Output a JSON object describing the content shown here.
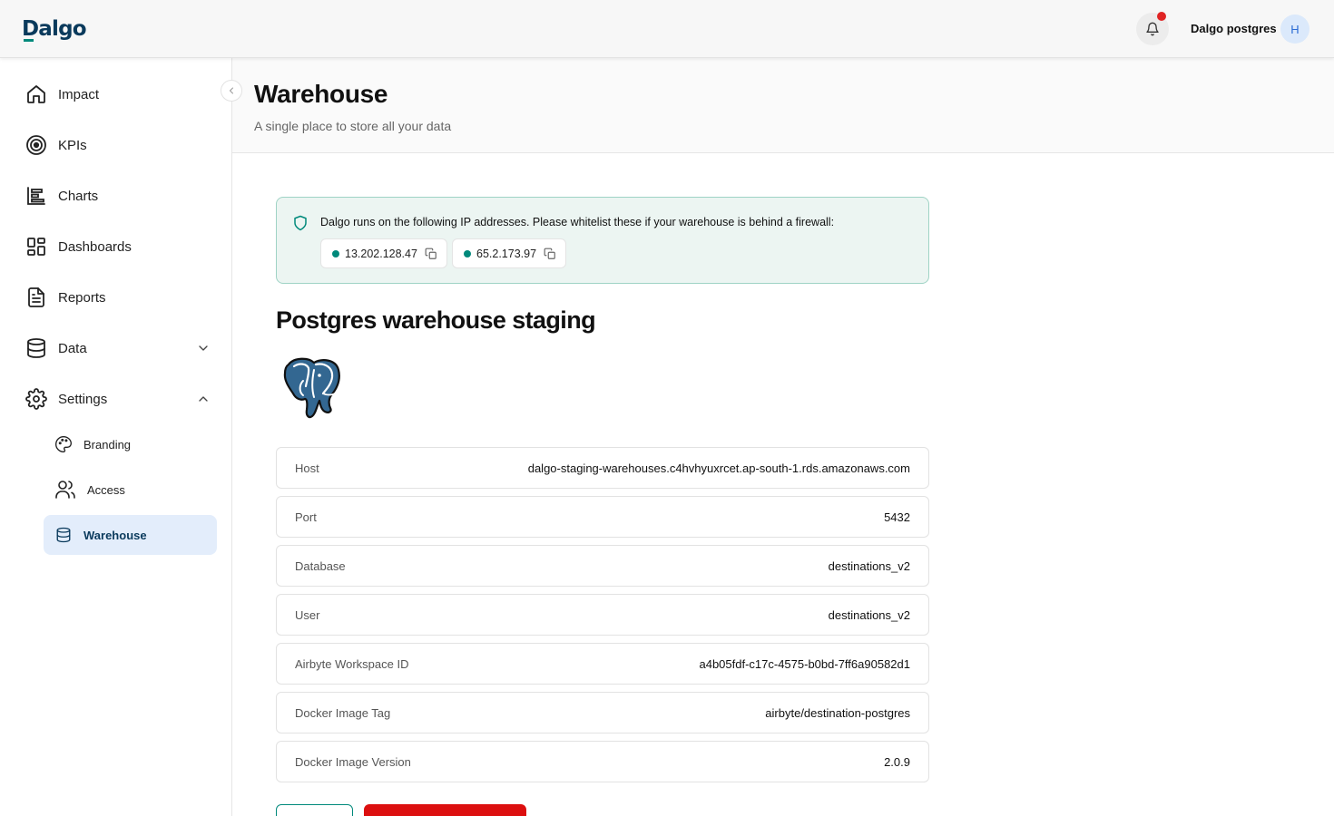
{
  "app": {
    "logo_text": "Dalgo"
  },
  "header": {
    "org_name": "Dalgo postgres",
    "avatar_initial": "H"
  },
  "sidebar": {
    "items": [
      {
        "label": "Impact"
      },
      {
        "label": "KPIs"
      },
      {
        "label": "Charts"
      },
      {
        "label": "Dashboards"
      },
      {
        "label": "Reports"
      },
      {
        "label": "Data"
      },
      {
        "label": "Settings"
      }
    ],
    "settings_subitems": [
      {
        "label": "Branding"
      },
      {
        "label": "Access"
      },
      {
        "label": "Warehouse",
        "active": true
      }
    ]
  },
  "page": {
    "title": "Warehouse",
    "subtitle": "A single place to store all your data"
  },
  "banner": {
    "text": "Dalgo runs on the following IP addresses. Please whitelist these if your warehouse is behind a firewall:",
    "ips": [
      "13.202.128.47",
      "65.2.173.97"
    ]
  },
  "warehouse": {
    "name": "Postgres warehouse staging",
    "logo_icon": "postgres-elephant-icon",
    "details": [
      {
        "label": "Host",
        "value": "dalgo-staging-warehouses.c4hvhyuxrcet.ap-south-1.rds.amazonaws.com"
      },
      {
        "label": "Port",
        "value": "5432"
      },
      {
        "label": "Database",
        "value": "destinations_v2"
      },
      {
        "label": "User",
        "value": "destinations_v2"
      },
      {
        "label": "Airbyte Workspace ID",
        "value": "a4b05fdf-c17c-4575-b0bd-7ff6a90582d1"
      },
      {
        "label": "Docker Image Tag",
        "value": "airbyte/destination-postgres"
      },
      {
        "label": "Docker Image Version",
        "value": "2.0.9"
      }
    ]
  },
  "colors": {
    "brand": "#0a3a5c",
    "accent": "#00897b",
    "active_bg": "#e3edfb",
    "banner_bg": "#ecf5f2",
    "danger": "#dc0f0f",
    "notification": "#e02424"
  }
}
